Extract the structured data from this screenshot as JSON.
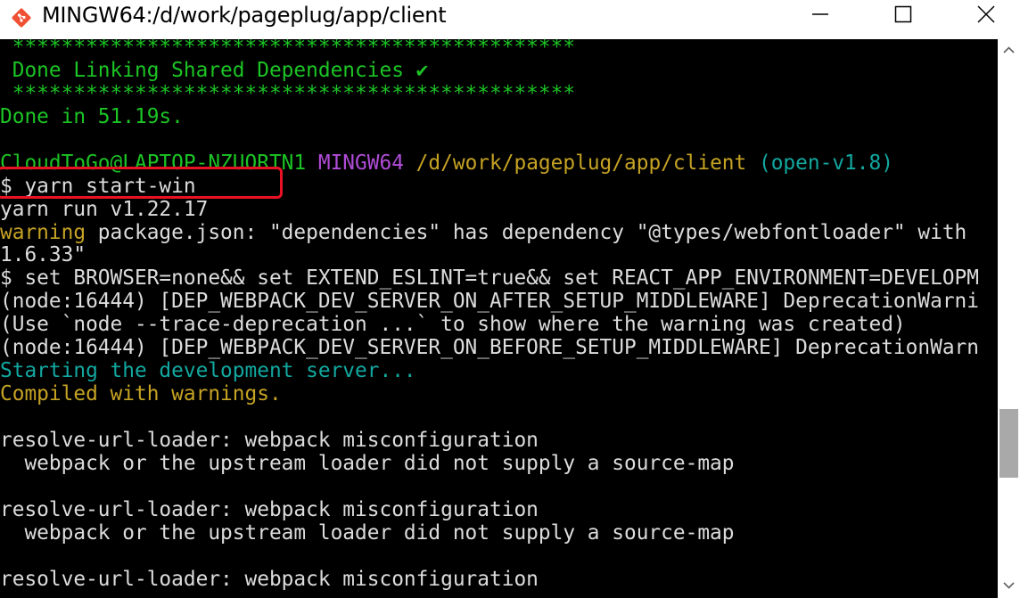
{
  "window": {
    "title": "MINGW64:/d/work/pageplug/app/client",
    "icon": "git-bash-icon",
    "accent": "#f05033"
  },
  "terminal": {
    "lines": [
      [
        {
          "t": " **********************************************",
          "c": "green"
        }
      ],
      [
        {
          "t": " Done Linking Shared Dependencies ✔",
          "c": "green"
        }
      ],
      [
        {
          "t": " **********************************************",
          "c": "green"
        }
      ],
      [
        {
          "t": "Done in 51.19s.",
          "c": "green"
        }
      ],
      [
        {
          "t": "",
          "c": "white"
        }
      ],
      [
        {
          "t": "CloudToGo@LAPTOP-NZUORTN1",
          "c": "green"
        },
        {
          "t": " ",
          "c": "white"
        },
        {
          "t": "MINGW64",
          "c": "magenta"
        },
        {
          "t": " ",
          "c": "white"
        },
        {
          "t": "/d/work/pageplug/app/client",
          "c": "yellow"
        },
        {
          "t": " ",
          "c": "white"
        },
        {
          "t": "(open-v1.8)",
          "c": "cyan"
        }
      ],
      [
        {
          "t": "$ yarn start-win",
          "c": "white"
        }
      ],
      [
        {
          "t": "yarn run v1.22.17",
          "c": "white"
        }
      ],
      [
        {
          "t": "warning",
          "c": "yellow"
        },
        {
          "t": " package.json: \"dependencies\" has dependency \"@types/webfontloader\" with",
          "c": "white"
        }
      ],
      [
        {
          "t": "1.6.33\"",
          "c": "white"
        }
      ],
      [
        {
          "t": "$ set BROWSER=none&& set EXTEND_ESLINT=true&& set REACT_APP_ENVIRONMENT=DEVELOPM",
          "c": "white"
        }
      ],
      [
        {
          "t": "(node:16444) [DEP_WEBPACK_DEV_SERVER_ON_AFTER_SETUP_MIDDLEWARE] DeprecationWarni",
          "c": "white"
        }
      ],
      [
        {
          "t": "(Use `node --trace-deprecation ...` to show where the warning was created)",
          "c": "white"
        }
      ],
      [
        {
          "t": "(node:16444) [DEP_WEBPACK_DEV_SERVER_ON_BEFORE_SETUP_MIDDLEWARE] DeprecationWarn",
          "c": "white"
        }
      ],
      [
        {
          "t": "Starting the development server...",
          "c": "cyan"
        }
      ],
      [
        {
          "t": "Compiled with warnings.",
          "c": "yellow"
        }
      ],
      [
        {
          "t": "",
          "c": "white"
        }
      ],
      [
        {
          "t": "resolve-url-loader: webpack misconfiguration",
          "c": "white"
        }
      ],
      [
        {
          "t": "  webpack or the upstream loader did not supply a source-map",
          "c": "white"
        }
      ],
      [
        {
          "t": "",
          "c": "white"
        }
      ],
      [
        {
          "t": "resolve-url-loader: webpack misconfiguration",
          "c": "white"
        }
      ],
      [
        {
          "t": "  webpack or the upstream loader did not supply a source-map",
          "c": "white"
        }
      ],
      [
        {
          "t": "",
          "c": "white"
        }
      ],
      [
        {
          "t": "resolve-url-loader: webpack misconfiguration",
          "c": "white"
        }
      ]
    ],
    "highlight_color": "#e81224"
  },
  "scrollbar": {
    "up_icon": "scroll-up-arrow-icon",
    "down_icon": "scroll-down-arrow-icon"
  }
}
